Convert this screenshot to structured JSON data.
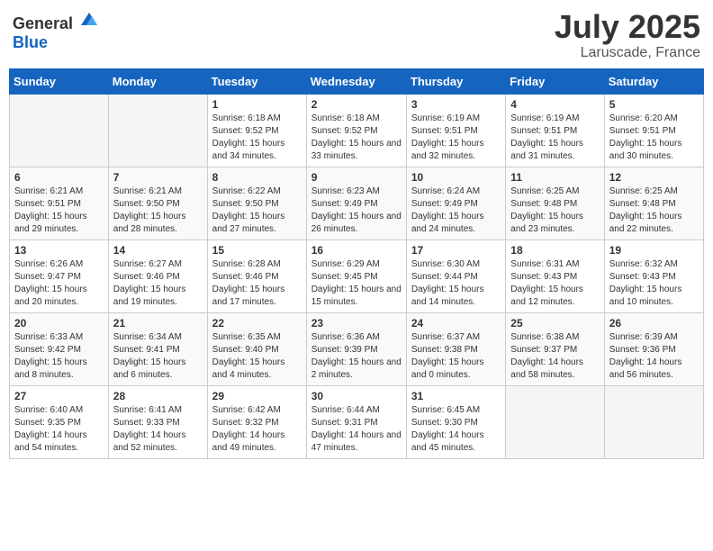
{
  "logo": {
    "general": "General",
    "blue": "Blue"
  },
  "title": "July 2025",
  "location": "Laruscade, France",
  "days_header": [
    "Sunday",
    "Monday",
    "Tuesday",
    "Wednesday",
    "Thursday",
    "Friday",
    "Saturday"
  ],
  "weeks": [
    [
      {
        "day": "",
        "info": ""
      },
      {
        "day": "",
        "info": ""
      },
      {
        "day": "1",
        "info": "Sunrise: 6:18 AM\nSunset: 9:52 PM\nDaylight: 15 hours and 34 minutes."
      },
      {
        "day": "2",
        "info": "Sunrise: 6:18 AM\nSunset: 9:52 PM\nDaylight: 15 hours and 33 minutes."
      },
      {
        "day": "3",
        "info": "Sunrise: 6:19 AM\nSunset: 9:51 PM\nDaylight: 15 hours and 32 minutes."
      },
      {
        "day": "4",
        "info": "Sunrise: 6:19 AM\nSunset: 9:51 PM\nDaylight: 15 hours and 31 minutes."
      },
      {
        "day": "5",
        "info": "Sunrise: 6:20 AM\nSunset: 9:51 PM\nDaylight: 15 hours and 30 minutes."
      }
    ],
    [
      {
        "day": "6",
        "info": "Sunrise: 6:21 AM\nSunset: 9:51 PM\nDaylight: 15 hours and 29 minutes."
      },
      {
        "day": "7",
        "info": "Sunrise: 6:21 AM\nSunset: 9:50 PM\nDaylight: 15 hours and 28 minutes."
      },
      {
        "day": "8",
        "info": "Sunrise: 6:22 AM\nSunset: 9:50 PM\nDaylight: 15 hours and 27 minutes."
      },
      {
        "day": "9",
        "info": "Sunrise: 6:23 AM\nSunset: 9:49 PM\nDaylight: 15 hours and 26 minutes."
      },
      {
        "day": "10",
        "info": "Sunrise: 6:24 AM\nSunset: 9:49 PM\nDaylight: 15 hours and 24 minutes."
      },
      {
        "day": "11",
        "info": "Sunrise: 6:25 AM\nSunset: 9:48 PM\nDaylight: 15 hours and 23 minutes."
      },
      {
        "day": "12",
        "info": "Sunrise: 6:25 AM\nSunset: 9:48 PM\nDaylight: 15 hours and 22 minutes."
      }
    ],
    [
      {
        "day": "13",
        "info": "Sunrise: 6:26 AM\nSunset: 9:47 PM\nDaylight: 15 hours and 20 minutes."
      },
      {
        "day": "14",
        "info": "Sunrise: 6:27 AM\nSunset: 9:46 PM\nDaylight: 15 hours and 19 minutes."
      },
      {
        "day": "15",
        "info": "Sunrise: 6:28 AM\nSunset: 9:46 PM\nDaylight: 15 hours and 17 minutes."
      },
      {
        "day": "16",
        "info": "Sunrise: 6:29 AM\nSunset: 9:45 PM\nDaylight: 15 hours and 15 minutes."
      },
      {
        "day": "17",
        "info": "Sunrise: 6:30 AM\nSunset: 9:44 PM\nDaylight: 15 hours and 14 minutes."
      },
      {
        "day": "18",
        "info": "Sunrise: 6:31 AM\nSunset: 9:43 PM\nDaylight: 15 hours and 12 minutes."
      },
      {
        "day": "19",
        "info": "Sunrise: 6:32 AM\nSunset: 9:43 PM\nDaylight: 15 hours and 10 minutes."
      }
    ],
    [
      {
        "day": "20",
        "info": "Sunrise: 6:33 AM\nSunset: 9:42 PM\nDaylight: 15 hours and 8 minutes."
      },
      {
        "day": "21",
        "info": "Sunrise: 6:34 AM\nSunset: 9:41 PM\nDaylight: 15 hours and 6 minutes."
      },
      {
        "day": "22",
        "info": "Sunrise: 6:35 AM\nSunset: 9:40 PM\nDaylight: 15 hours and 4 minutes."
      },
      {
        "day": "23",
        "info": "Sunrise: 6:36 AM\nSunset: 9:39 PM\nDaylight: 15 hours and 2 minutes."
      },
      {
        "day": "24",
        "info": "Sunrise: 6:37 AM\nSunset: 9:38 PM\nDaylight: 15 hours and 0 minutes."
      },
      {
        "day": "25",
        "info": "Sunrise: 6:38 AM\nSunset: 9:37 PM\nDaylight: 14 hours and 58 minutes."
      },
      {
        "day": "26",
        "info": "Sunrise: 6:39 AM\nSunset: 9:36 PM\nDaylight: 14 hours and 56 minutes."
      }
    ],
    [
      {
        "day": "27",
        "info": "Sunrise: 6:40 AM\nSunset: 9:35 PM\nDaylight: 14 hours and 54 minutes."
      },
      {
        "day": "28",
        "info": "Sunrise: 6:41 AM\nSunset: 9:33 PM\nDaylight: 14 hours and 52 minutes."
      },
      {
        "day": "29",
        "info": "Sunrise: 6:42 AM\nSunset: 9:32 PM\nDaylight: 14 hours and 49 minutes."
      },
      {
        "day": "30",
        "info": "Sunrise: 6:44 AM\nSunset: 9:31 PM\nDaylight: 14 hours and 47 minutes."
      },
      {
        "day": "31",
        "info": "Sunrise: 6:45 AM\nSunset: 9:30 PM\nDaylight: 14 hours and 45 minutes."
      },
      {
        "day": "",
        "info": ""
      },
      {
        "day": "",
        "info": ""
      }
    ]
  ]
}
